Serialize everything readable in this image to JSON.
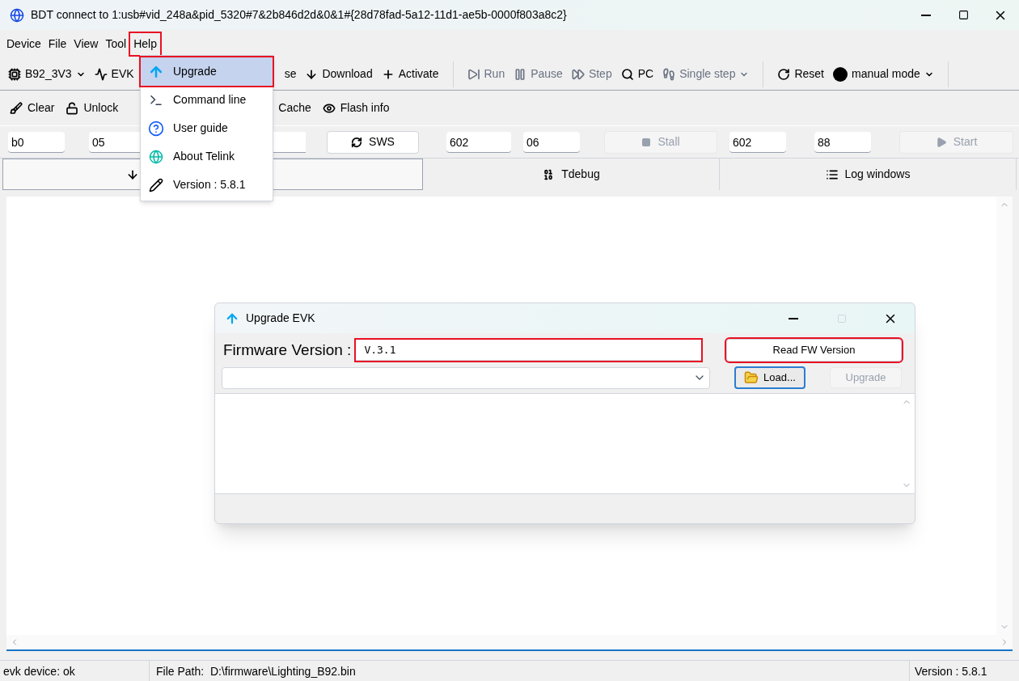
{
  "window": {
    "title": "BDT connect to 1:usb#vid_248a&pid_5320#7&2b846d2d&0&1#{28d78fad-5a12-11d1-ae5b-0000f803a8c2}"
  },
  "menu_bar": [
    {
      "label": "Device",
      "annotated": false
    },
    {
      "label": "File",
      "annotated": false
    },
    {
      "label": "View",
      "annotated": false
    },
    {
      "label": "Tool",
      "annotated": false
    },
    {
      "label": "Help",
      "annotated": true
    }
  ],
  "help_menu": [
    {
      "label": "Upgrade",
      "selected": true,
      "annotated": true
    },
    {
      "label": "Command line",
      "selected": false,
      "annotated": false
    },
    {
      "label": "User guide",
      "selected": false,
      "annotated": false
    },
    {
      "label": "About Telink",
      "selected": false,
      "annotated": false
    },
    {
      "label": "Version : 5.8.1",
      "selected": false,
      "annotated": false
    }
  ],
  "toolbar_1": [
    {
      "label": "B92_3V3",
      "dropdown": true,
      "disabled": false
    },
    {
      "label": "EVK",
      "dropdown": false,
      "disabled": false
    },
    {
      "label": "se",
      "dropdown": false,
      "disabled": false
    },
    {
      "label": "Download",
      "dropdown": false,
      "disabled": false
    },
    {
      "label": "Activate",
      "dropdown": false,
      "disabled": false
    },
    {
      "label": "Run",
      "dropdown": false,
      "disabled": true
    },
    {
      "label": "Pause",
      "dropdown": false,
      "disabled": true
    },
    {
      "label": "Step",
      "dropdown": false,
      "disabled": true
    },
    {
      "label": "PC",
      "dropdown": false,
      "disabled": false
    },
    {
      "label": "Single step",
      "dropdown": true,
      "disabled": true
    },
    {
      "label": "Reset",
      "dropdown": false,
      "disabled": false
    },
    {
      "label": "manual mode",
      "dropdown": true,
      "disabled": false
    }
  ],
  "toolbar_2": [
    {
      "label": "Clear"
    },
    {
      "label": "Unlock"
    },
    {
      "label": "Cache"
    },
    {
      "label": "Flash info"
    }
  ],
  "register_row": [
    "b0",
    "05",
    "602",
    "06",
    "602",
    "88"
  ],
  "sws_button": {
    "label": "SWS",
    "disabled": false
  },
  "stall_button": {
    "label": "Stall",
    "disabled": true
  },
  "start_button": {
    "label": "Start",
    "disabled": true
  },
  "tabs": [
    {
      "selected": true
    },
    {
      "label": "Tdebug",
      "selected": false
    },
    {
      "label": "Log windows",
      "selected": false
    }
  ],
  "dialog": {
    "title": "Upgrade EVK",
    "label": "Firmware Version :",
    "version": {
      "value": "V.3.1",
      "annotated": true
    },
    "read_button": {
      "label": "Read FW Version",
      "annotated": true,
      "disabled": false
    },
    "load_button": {
      "label": "Load...",
      "disabled": false
    },
    "upgrade_button": {
      "label": "Upgrade",
      "disabled": true
    }
  },
  "status_bar": {
    "device": "evk device: ok",
    "file_path": "File Path:  D:\\firmware\\Lighting_B92.bin",
    "version": "Version : 5.8.1"
  }
}
